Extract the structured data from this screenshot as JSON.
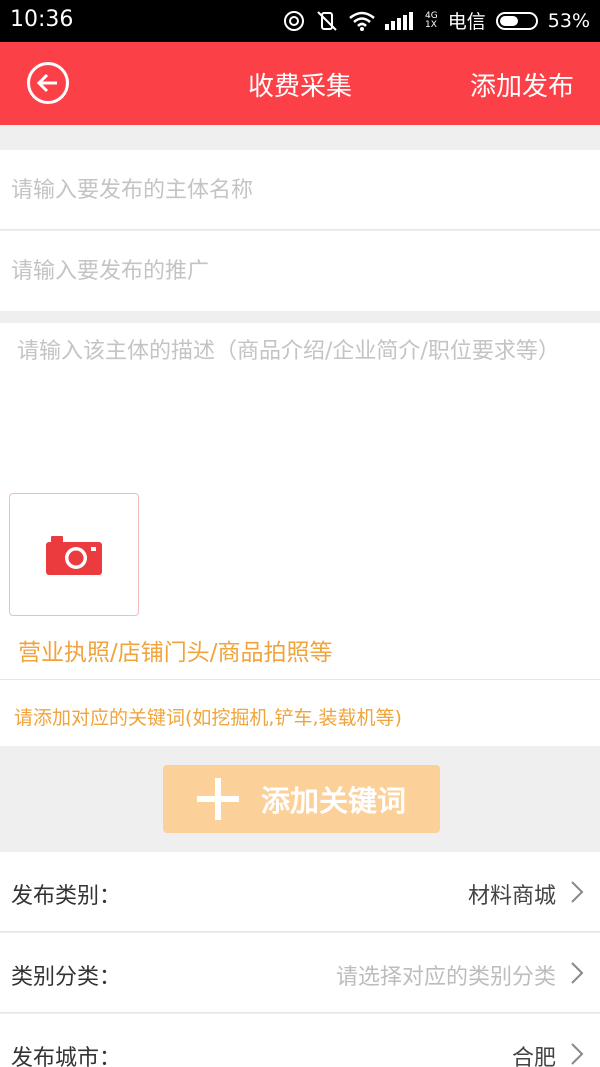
{
  "status_bar": {
    "time": "10:36",
    "network_top": "4G",
    "network_bottom": "1X",
    "carrier": "电信",
    "battery": "53%",
    "battery_level": 0.53
  },
  "nav": {
    "title": "收费采集",
    "action": "添加发布",
    "back_icon": "back-arrow-circle-icon"
  },
  "form": {
    "name_placeholder": "请输入要发布的主体名称",
    "promo_placeholder": "请输入要发布的推广",
    "desc_placeholder": "请输入该主体的描述（商品介绍/企业简介/职位要求等）",
    "photo_icon": "camera-icon",
    "photo_hint": "营业执照/店铺门头/商品拍照等",
    "keyword_hint": "请添加对应的关键词(如挖掘机,铲车,装载机等)",
    "add_keyword_label": "添加关键词"
  },
  "options": [
    {
      "label": "发布类别：",
      "value": "材料商城",
      "placeholder": false
    },
    {
      "label": "类别分类：",
      "value": "请选择对应的类别分类",
      "placeholder": true
    },
    {
      "label": "发布城市：",
      "value": "合肥",
      "placeholder": false
    }
  ],
  "colors": {
    "brand": "#fb4147",
    "accent": "#f0a43b",
    "button_bg": "#fcd099"
  }
}
